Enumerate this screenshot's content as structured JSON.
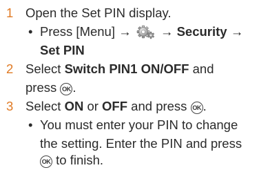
{
  "steps": [
    {
      "num": "1",
      "text": "Open the Set PIN display."
    },
    {
      "num": "2",
      "pre": "Select ",
      "bold": "Switch PIN1 ON/OFF",
      "post": " and",
      "line2": "press",
      "end": "."
    },
    {
      "num": "3",
      "pre": "Select ",
      "bold1": "ON",
      "mid": " or ",
      "bold2": "OFF",
      "post": " and press",
      "end": "."
    }
  ],
  "bullet1": {
    "bullet": "•",
    "pre": "Press [Menu] →",
    "arrow": "→",
    "security": "Security",
    "arrow2": "→",
    "setpin": "Set PIN"
  },
  "bullet2": {
    "bullet": "•",
    "line1": "You must enter your PIN to change",
    "line2": "the setting. Enter the PIN and press",
    "line3": "to finish."
  },
  "ok_key_label": "OK",
  "icons": {
    "settings": "settings-gear-icon",
    "ok": "ok-key-icon"
  },
  "colors": {
    "step_number": "#e07a24",
    "text": "#2b2b2b"
  }
}
